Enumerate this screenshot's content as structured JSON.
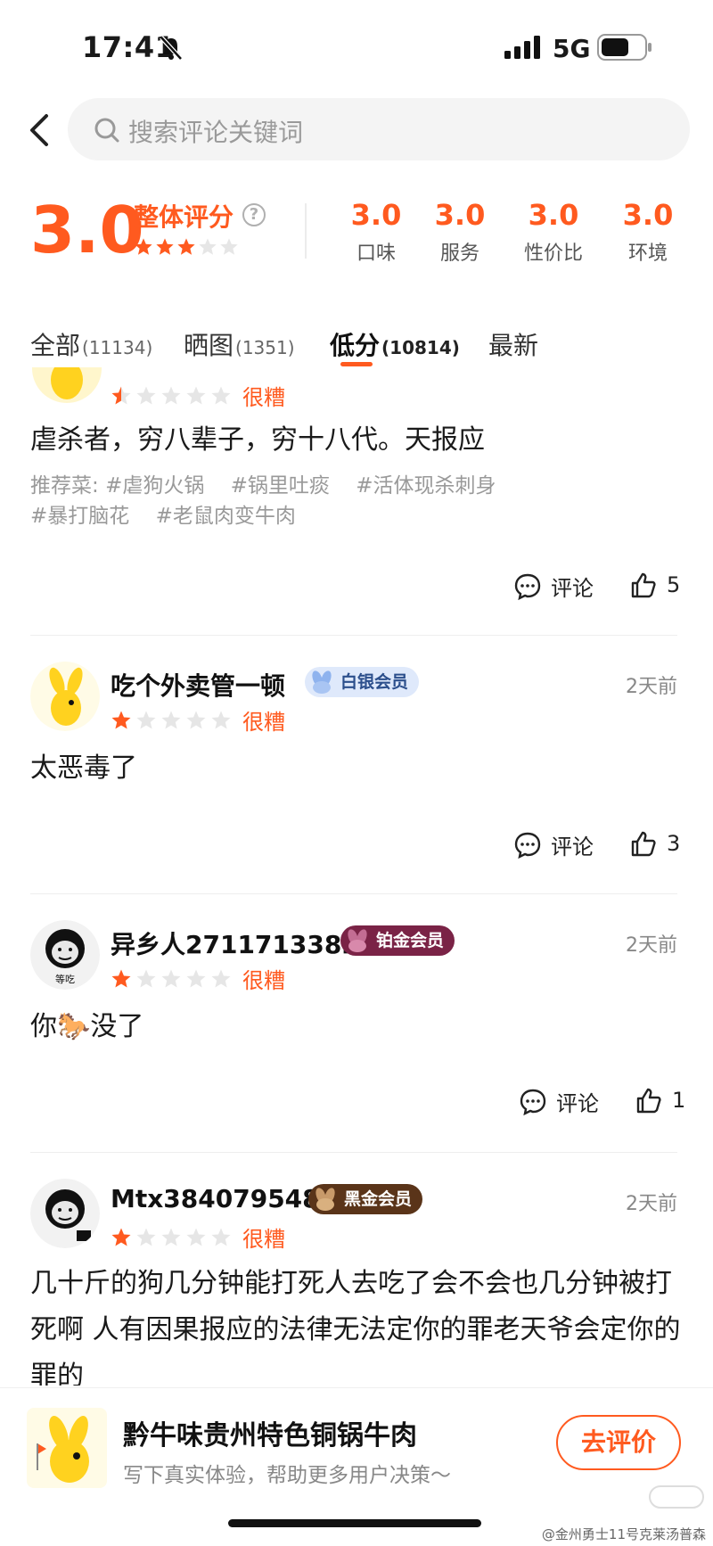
{
  "status_bar": {
    "time": "17:41",
    "network": "5G"
  },
  "search": {
    "placeholder": "搜索评论关键词"
  },
  "summary": {
    "overall_score": "3.0",
    "overall_label": "整体评分",
    "overall_stars": 3,
    "sub_scores": [
      {
        "value": "3.0",
        "label": "口味"
      },
      {
        "value": "3.0",
        "label": "服务"
      },
      {
        "value": "3.0",
        "label": "性价比"
      },
      {
        "value": "3.0",
        "label": "环境"
      }
    ]
  },
  "tabs": [
    {
      "label": "全部",
      "count": "(11134)"
    },
    {
      "label": "晒图",
      "count": "(1351)"
    },
    {
      "label": "低分",
      "count": "(10814)",
      "active": true
    },
    {
      "label": "最新",
      "count": ""
    }
  ],
  "reviews": [
    {
      "rating_label": "很糟",
      "stars": 0.5,
      "text": "虐杀者，穷八辈子，穷十八代。天报应",
      "tags_prefix": "推荐菜:",
      "tags": [
        "#虐狗火锅",
        "#锅里吐痰",
        "#活体现杀刺身",
        "#暴打脑花",
        "#老鼠肉变牛肉"
      ],
      "comment_label": "评论",
      "likes": "5"
    },
    {
      "username": "吃个外卖管一顿",
      "badge": "白银会员",
      "time": "2天前",
      "stars": 1,
      "rating_label": "很糟",
      "text": "太恶毒了",
      "comment_label": "评论",
      "likes": "3"
    },
    {
      "username": "异乡人2711713382",
      "badge": "铂金会员",
      "avatar_caption": "等吃",
      "time": "2天前",
      "stars": 1,
      "rating_label": "很糟",
      "text": "你🐎没了",
      "comment_label": "评论",
      "likes": "1"
    },
    {
      "username": "Mtx384079548",
      "badge": "黑金会员",
      "time": "2天前",
      "stars": 1,
      "rating_label": "很糟",
      "text": "几十斤的狗几分钟能打死人去吃了会不会也几分钟被打死啊 人有因果报应的法律无法定你的罪老天爷会定你的罪的"
    }
  ],
  "bottom_bar": {
    "shop_name": "黔牛味贵州特色铜锅牛肉",
    "hint": "写下真实体验，帮助更多用户决策～",
    "button": "去评价"
  },
  "watermark": "@金州勇士11号克莱汤普森",
  "colors": {
    "accent": "#ff5a1f",
    "silver_badge": "#dfe9fb",
    "platinum_badge": "#7a2346",
    "black_gold_badge": "#5a3419"
  }
}
